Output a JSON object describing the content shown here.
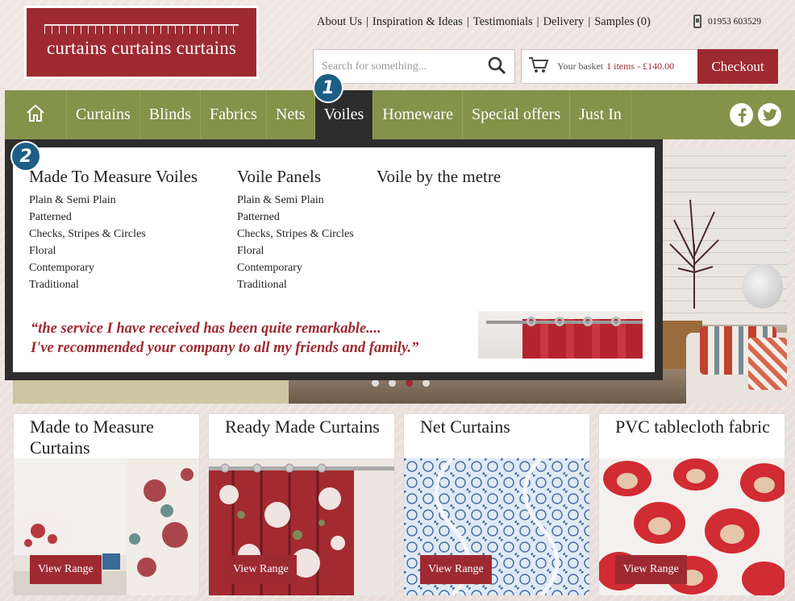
{
  "logo": {
    "text": "curtains curtains curtains"
  },
  "toplinks": [
    "About Us",
    "Inspiration & Ideas",
    "Testimonials",
    "Delivery",
    "Samples (0)"
  ],
  "phone": "01953 603529",
  "search": {
    "placeholder": "Search for something..."
  },
  "basket": {
    "label": "Your basket",
    "items": "1 items - £140.00"
  },
  "checkout": "Checkout",
  "nav": [
    "Curtains",
    "Blinds",
    "Fabrics",
    "Nets",
    "Voiles",
    "Homeware",
    "Special offers",
    "Just In"
  ],
  "nav_active": "Voiles",
  "badges": [
    "1",
    "2"
  ],
  "dropdown": {
    "col1": {
      "title": "Made To Measure Voiles",
      "items": [
        "Plain & Semi Plain",
        "Patterned",
        "Checks, Stripes & Circles",
        "Floral",
        "Contemporary",
        "Traditional"
      ]
    },
    "col2": {
      "title": "Voile Panels",
      "items": [
        "Plain & Semi Plain",
        "Patterned",
        "Checks, Stripes & Circles",
        "Floral",
        "Contemporary",
        "Traditional"
      ]
    },
    "col3": {
      "title": "Voile by the metre"
    },
    "quote_line1": "“the service I have received has been quite remarkable....",
    "quote_line2": "I've recommended your company to all my friends and family.”"
  },
  "carousel": {
    "slides": 4,
    "active_index": 2
  },
  "cards": [
    {
      "title": "Made to Measure Curtains",
      "button": "View Range"
    },
    {
      "title": "Ready Made Curtains",
      "button": "View Range"
    },
    {
      "title": "Net Curtains",
      "button": "View Range"
    },
    {
      "title": "PVC tablecloth fabric",
      "button": "View Range"
    }
  ],
  "colors": {
    "brand_red": "#9e2a31",
    "nav_green": "#84924a",
    "nav_active": "#2d2d2d",
    "badge_blue": "#1c5e86"
  }
}
